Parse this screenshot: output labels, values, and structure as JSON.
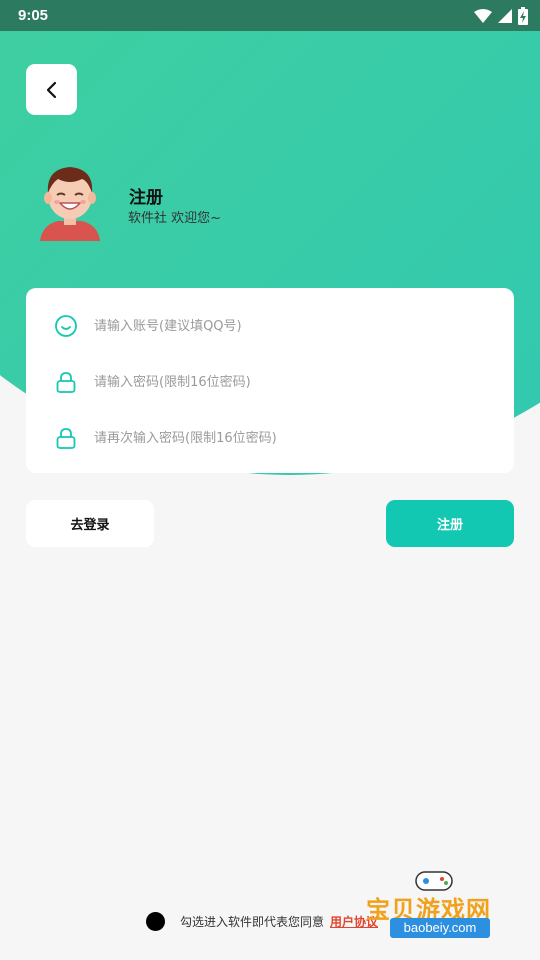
{
  "status_bar": {
    "time": "9:05",
    "icons": [
      "wifi-icon",
      "signal-icon",
      "battery-charging-icon"
    ]
  },
  "header": {
    "back_icon": "chevron-left-icon",
    "title": "注册",
    "subtitle": "软件社 欢迎您~"
  },
  "form": {
    "account": {
      "icon": "smile-icon",
      "placeholder": "请输入账号(建议填QQ号)",
      "value": ""
    },
    "password": {
      "icon": "lock-icon",
      "placeholder": "请输入密码(限制16位密码)",
      "value": ""
    },
    "confirm_password": {
      "icon": "lock-icon",
      "placeholder": "请再次输入密码(限制16位密码)",
      "value": ""
    }
  },
  "actions": {
    "login_label": "去登录",
    "register_label": "注册"
  },
  "agreement": {
    "text": "勾选进入软件即代表您同意",
    "link": "用户协议"
  },
  "watermark": {
    "text": "宝贝游戏网",
    "url": "baobeiy.com"
  },
  "colors": {
    "accent": "#12c8b2",
    "gradient_start": "#4dd58f",
    "gradient_end": "#2ec7b4",
    "link": "#e0462f"
  }
}
